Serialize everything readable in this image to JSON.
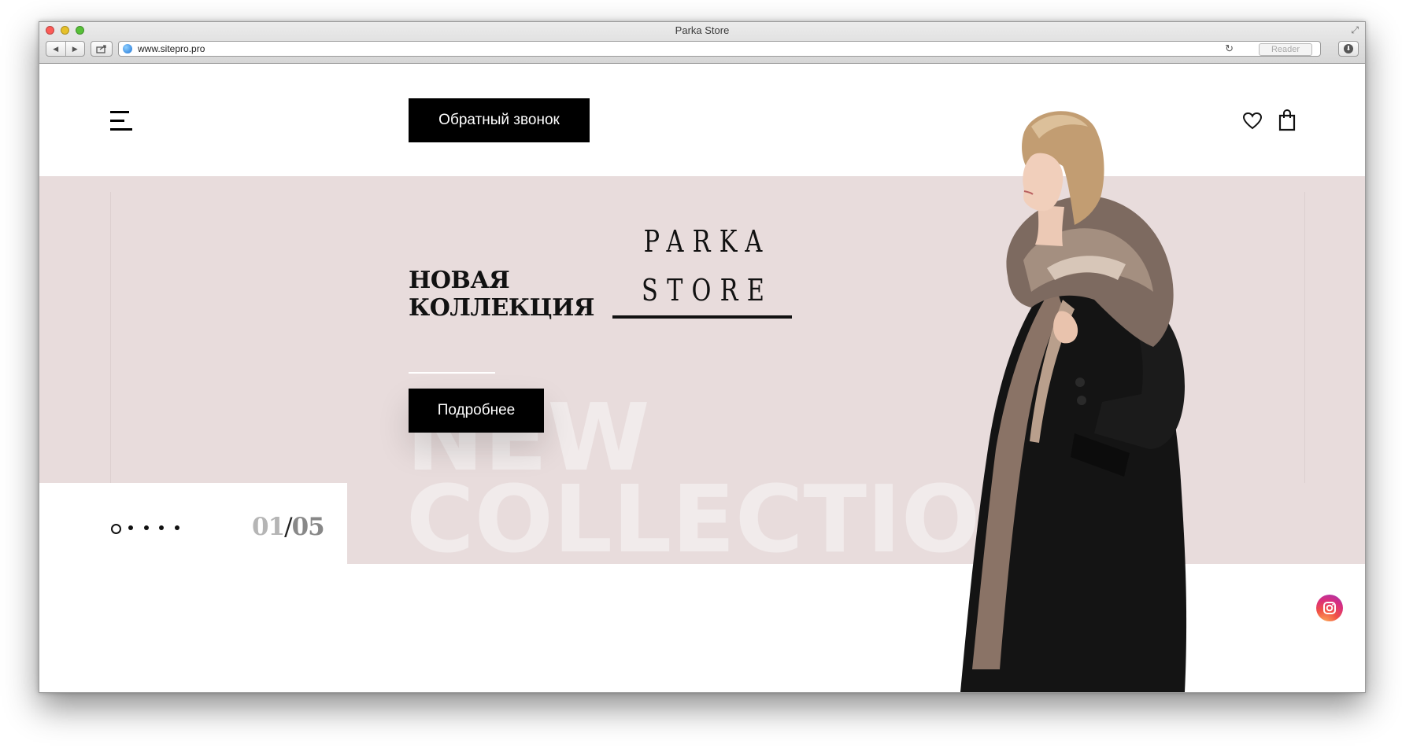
{
  "window": {
    "title": "Parka Store",
    "url": "www.sitepro.pro",
    "reader_label": "Reader"
  },
  "header": {
    "callback_label": "Обратный звонок"
  },
  "hero": {
    "headline_line1": "НОВАЯ",
    "headline_line2": "КОЛЛЕКЦИЯ",
    "logo_line1": "PARKA",
    "logo_line2": "STORE",
    "more_label": "Подробнее",
    "watermark": "NEW\nCOLLECTION"
  },
  "slider": {
    "current": "01",
    "separator": "/",
    "total": "05",
    "dots": 5,
    "active_index": 0
  },
  "colors": {
    "hero_background": "#e8dcdc",
    "button_background": "#000000",
    "instagram": "#e1306c"
  },
  "icons": {
    "menu": "menu-icon",
    "wishlist": "heart-icon",
    "cart": "bag-icon",
    "social": "instagram-icon"
  }
}
